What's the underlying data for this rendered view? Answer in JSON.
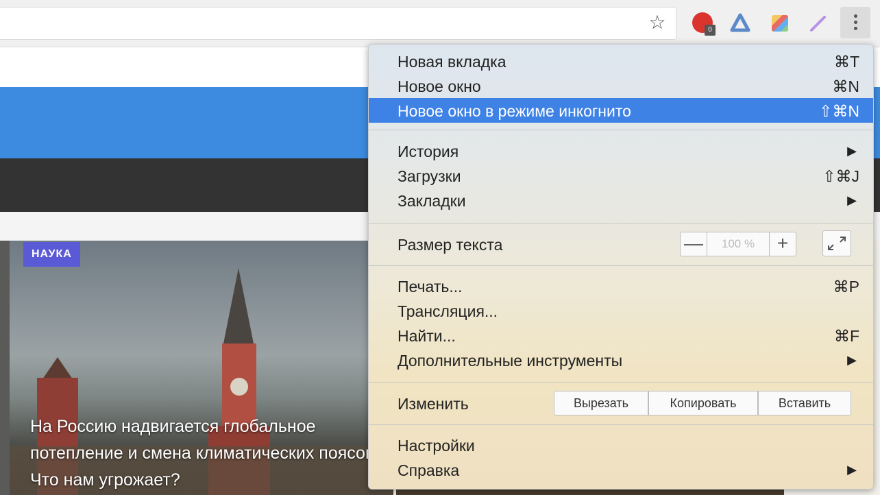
{
  "toolbar": {
    "star_icon": "star-icon",
    "extensions": [
      "adblock-extension-icon",
      "alice-extension-icon",
      "photo-extension-icon",
      "pen-extension-icon"
    ],
    "menu_icon": "more-vertical-icon"
  },
  "page": {
    "category_badge": "НАУКА",
    "hero_title": "На Россию надвигается глобальное потепление и смена климатических поясов. Что нам угрожает?"
  },
  "menu": {
    "items": [
      {
        "label": "Новая вкладка",
        "shortcut": "⌘T"
      },
      {
        "label": "Новое окно",
        "shortcut": "⌘N"
      },
      {
        "label": "Новое окно в режиме инкогнито",
        "shortcut": "⇧⌘N",
        "highlighted": true
      },
      {
        "label": "История",
        "arrow": "▶"
      },
      {
        "label": "Загрузки",
        "shortcut": "⇧⌘J"
      },
      {
        "label": "Закладки",
        "arrow": "▶"
      },
      {
        "label": "Размер текста"
      },
      {
        "label": "Печать...",
        "shortcut": "⌘P"
      },
      {
        "label": "Трансляция..."
      },
      {
        "label": "Найти...",
        "shortcut": "⌘F"
      },
      {
        "label": "Дополнительные инструменты",
        "arrow": "▶"
      },
      {
        "label": "Изменить"
      },
      {
        "label": "Настройки"
      },
      {
        "label": "Справка",
        "arrow": "▶"
      }
    ],
    "zoom": {
      "minus": "—",
      "value": "100 %",
      "plus": "+"
    },
    "edit": {
      "cut": "Вырезать",
      "copy": "Копировать",
      "paste": "Вставить"
    }
  },
  "colors": {
    "highlight": "#3f82e6",
    "header_blue": "#3d8be0",
    "badge": "#5b5ad6"
  }
}
